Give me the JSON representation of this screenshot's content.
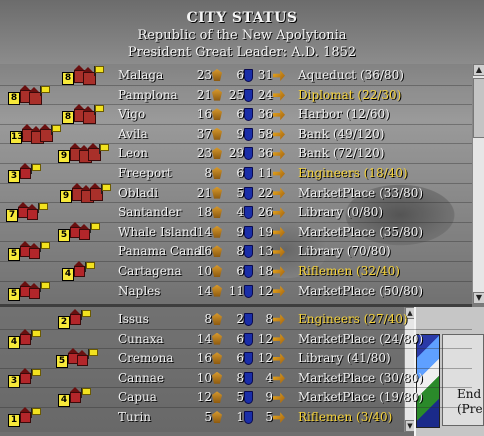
{
  "header": {
    "title": "CITY STATUS",
    "nation": "Republic of the New Apolytonia",
    "leader": "President Great Leader: A.D. 1852"
  },
  "colors": {
    "unit_text": "#f5d23a",
    "text": "#f0f0f0",
    "size_box": "#f7e93a"
  },
  "cities": [
    {
      "size": "8",
      "name": "Malaga",
      "food": "23",
      "shields": "6",
      "trade": "31",
      "production": "Aqueduct",
      "progress": "(36/80)",
      "is_unit": false
    },
    {
      "size": "8",
      "name": "Pamplona",
      "food": "21",
      "shields": "25",
      "trade": "24",
      "production": "Diplomat",
      "progress": "(22/30)",
      "is_unit": true
    },
    {
      "size": "8",
      "name": "Vigo",
      "food": "16",
      "shields": "6",
      "trade": "36",
      "production": "Harbor",
      "progress": "(12/60)",
      "is_unit": false
    },
    {
      "size": "13",
      "name": "Avila",
      "food": "37",
      "shields": "9",
      "trade": "58",
      "production": "Bank",
      "progress": "(49/120)",
      "is_unit": false
    },
    {
      "size": "9",
      "name": "Leon",
      "food": "23",
      "shields": "29",
      "trade": "36",
      "production": "Bank",
      "progress": "(72/120)",
      "is_unit": false
    },
    {
      "size": "3",
      "name": "Freeport",
      "food": "8",
      "shields": "6",
      "trade": "11",
      "production": "Engineers",
      "progress": "(18/40)",
      "is_unit": true
    },
    {
      "size": "9",
      "name": "Obladi",
      "food": "21",
      "shields": "5",
      "trade": "22",
      "production": "MarketPlace",
      "progress": "(33/80)",
      "is_unit": false
    },
    {
      "size": "7",
      "name": "Santander",
      "food": "18",
      "shields": "4",
      "trade": "26",
      "production": "Library",
      "progress": "(0/80)",
      "is_unit": false
    },
    {
      "size": "5",
      "name": "Whale Island",
      "food": "14",
      "shields": "9",
      "trade": "19",
      "production": "MarketPlace",
      "progress": "(35/80)",
      "is_unit": false
    },
    {
      "size": "5",
      "name": "Panama Canal",
      "food": "16",
      "shields": "8",
      "trade": "13",
      "production": "Library",
      "progress": "(70/80)",
      "is_unit": false
    },
    {
      "size": "4",
      "name": "Cartagena",
      "food": "10",
      "shields": "6",
      "trade": "18",
      "production": "Riflemen",
      "progress": "(32/40)",
      "is_unit": true
    },
    {
      "size": "5",
      "name": "Naples",
      "food": "14",
      "shields": "11",
      "trade": "12",
      "production": "MarketPlace",
      "progress": "(50/80)",
      "is_unit": false
    }
  ],
  "cities2": [
    {
      "size": "2",
      "name": "Issus",
      "food": "8",
      "shields": "2",
      "trade": "8",
      "production": "Engineers",
      "progress": "(27/40)",
      "is_unit": true
    },
    {
      "size": "4",
      "name": "Cunaxa",
      "food": "14",
      "shields": "6",
      "trade": "12",
      "production": "MarketPlace",
      "progress": "(24/80)",
      "is_unit": false
    },
    {
      "size": "5",
      "name": "Cremona",
      "food": "16",
      "shields": "6",
      "trade": "12",
      "production": "Library",
      "progress": "(41/80)",
      "is_unit": false
    },
    {
      "size": "3",
      "name": "Cannae",
      "food": "10",
      "shields": "8",
      "trade": "4",
      "production": "MarketPlace",
      "progress": "(30/80)",
      "is_unit": false
    },
    {
      "size": "4",
      "name": "Capua",
      "food": "12",
      "shields": "5",
      "trade": "9",
      "production": "MarketPlace",
      "progress": "(19/80)",
      "is_unit": false
    },
    {
      "size": "1",
      "name": "Turin",
      "food": "5",
      "shields": "1",
      "trade": "5",
      "production": "Riflemen",
      "progress": "(3/40)",
      "is_unit": true
    }
  ],
  "side": {
    "end_turn": "End",
    "end_turn_sub": "(Pre"
  }
}
